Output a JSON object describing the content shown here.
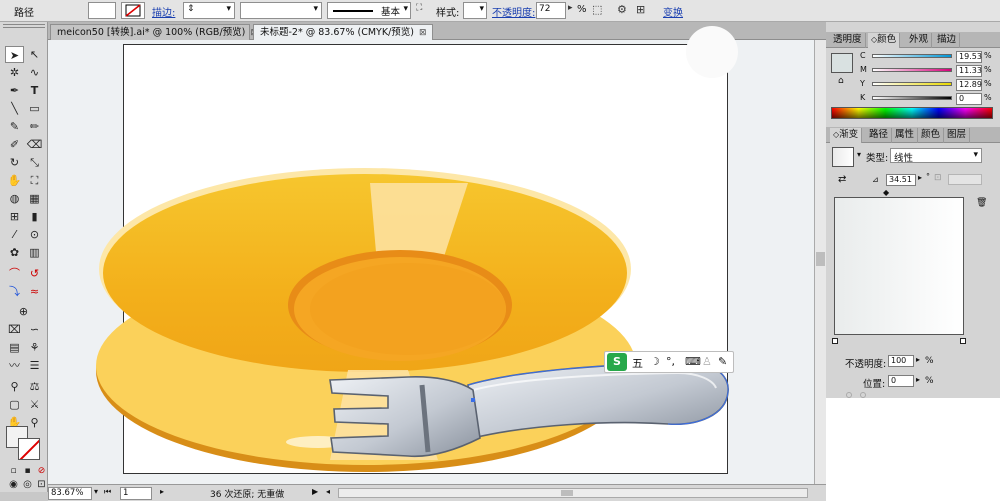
{
  "control_bar": {
    "object_type": "路径",
    "stroke_label": "描边:",
    "stroke_style_name": "基本",
    "style_label": "样式:",
    "opacity_label": "不透明度:",
    "opacity_value": "72",
    "opacity_unit": "%",
    "transform_label": "变换"
  },
  "doc_tabs": [
    {
      "label": "meicon50 [转换].ai* @ 100% (RGB/预览)",
      "close": "⊠"
    },
    {
      "label": "未标题-2* @ 83.67% (CMYK/预览)",
      "close": "⊠"
    }
  ],
  "tools": [
    "select",
    "direct-select",
    "magic-wand",
    "lasso",
    "pen",
    "type",
    "line",
    "rectangle",
    "paintbrush",
    "pencil",
    "blob-brush",
    "eraser",
    "rotate",
    "scale",
    "warp",
    "free-transform",
    "shape-builder",
    "perspective-grid",
    "mesh",
    "gradient",
    "eyedropper",
    "blend",
    "symbol-sprayer",
    "column-graph",
    "artboard",
    "slice",
    "hand",
    "zoom"
  ],
  "status_bar": {
    "zoom": "83.67%",
    "artboard_num": "1",
    "undo_text": "36 次还原; 无重做"
  },
  "color_panel": {
    "tabs": [
      "透明度",
      "颜色",
      "外观",
      "描边"
    ],
    "active_tab": "颜色",
    "channels": [
      {
        "name": "C",
        "value": "19.53",
        "color": "#0096d6"
      },
      {
        "name": "M",
        "value": "11.33",
        "color": "#d6007a"
      },
      {
        "name": "Y",
        "value": "12.89",
        "color": "#e8d800"
      },
      {
        "name": "K",
        "value": "0",
        "color": "#000000"
      }
    ]
  },
  "gradient_panel": {
    "tabs": [
      "渐变",
      "路径",
      "属性",
      "颜色",
      "图层"
    ],
    "active_tab": "渐变",
    "type_label": "类型:",
    "type_value": "线性",
    "angle_value": "34.51",
    "angle_unit": "°",
    "opacity_label": "不透明度:",
    "opacity_value": "100",
    "opacity_unit": "%",
    "location_label": "位置:",
    "location_value": "0",
    "location_unit": "%"
  },
  "ime_toolbar": {
    "logo": "S",
    "mode": "五",
    "items": [
      "☽",
      "°,",
      "⌨",
      "♙",
      "✎"
    ]
  },
  "colors": {
    "plate_outer": "#f2b21b",
    "plate_inner": "#f4a420",
    "plate_rim_shadow": "#e2870f",
    "highlight": "#fde3a6",
    "fork_body": "#b8bfc9",
    "fork_outline": "#5a6270",
    "selection_path": "#3a6ee8"
  }
}
